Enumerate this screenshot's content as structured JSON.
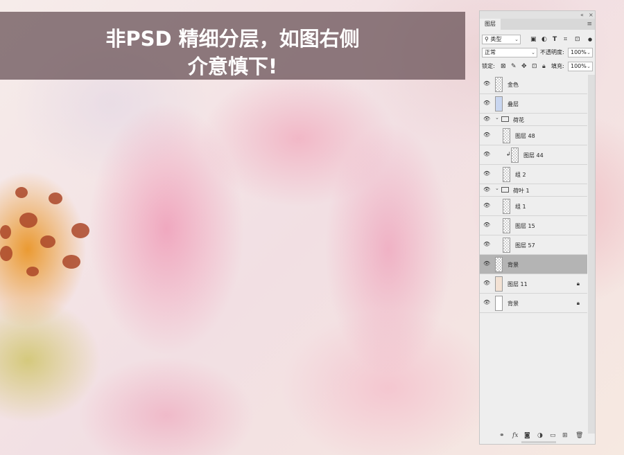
{
  "banner": {
    "line1": "非PSD 精细分层，如图右侧",
    "line2": "介意慎下!"
  },
  "panel": {
    "tab_label": "图层",
    "collapse_icon": "«",
    "close_icon": "×",
    "menu_icon": "≡",
    "filter_kind": "类型",
    "blend_mode": "正常",
    "opacity_label": "不透明度:",
    "opacity_value": "100%",
    "lock_label": "锁定:",
    "fill_label": "填充:",
    "fill_value": "100%",
    "layers": [
      {
        "name": "金色",
        "type": "layer",
        "thumb": "checker"
      },
      {
        "name": "叠层",
        "type": "layer",
        "thumb": "solid",
        "thumb_color": "#c9d6f0"
      },
      {
        "name": "荷花",
        "type": "group"
      },
      {
        "name": "图层 48",
        "type": "layer",
        "thumb": "checker"
      },
      {
        "name": "图层 44",
        "type": "layer",
        "thumb": "checker",
        "clipped": true
      },
      {
        "name": "组 2",
        "type": "layer",
        "thumb": "checker"
      },
      {
        "name": "荷叶 1",
        "type": "group"
      },
      {
        "name": "组 1",
        "type": "layer",
        "thumb": "checker"
      },
      {
        "name": "图层 15",
        "type": "layer",
        "thumb": "checker"
      },
      {
        "name": "图层 57",
        "type": "layer",
        "thumb": "checker"
      },
      {
        "name": "背景",
        "type": "layer",
        "thumb": "checker",
        "selected": true
      },
      {
        "name": "图层 11",
        "type": "layer",
        "thumb": "solid",
        "thumb_color": "#f3e2d4",
        "locked": true
      },
      {
        "name": "背景",
        "type": "layer",
        "thumb": "solid",
        "thumb_color": "#ffffff",
        "locked": true
      }
    ],
    "bottom_icons": [
      "link-icon",
      "fx-icon",
      "mask-icon",
      "adjustment-icon",
      "folder-icon",
      "new-layer-icon",
      "trash-icon"
    ]
  },
  "colors": {
    "banner_bg": "#644c52",
    "panel_bg": "#eeeeee",
    "selected_row": "#b4b4b4"
  }
}
